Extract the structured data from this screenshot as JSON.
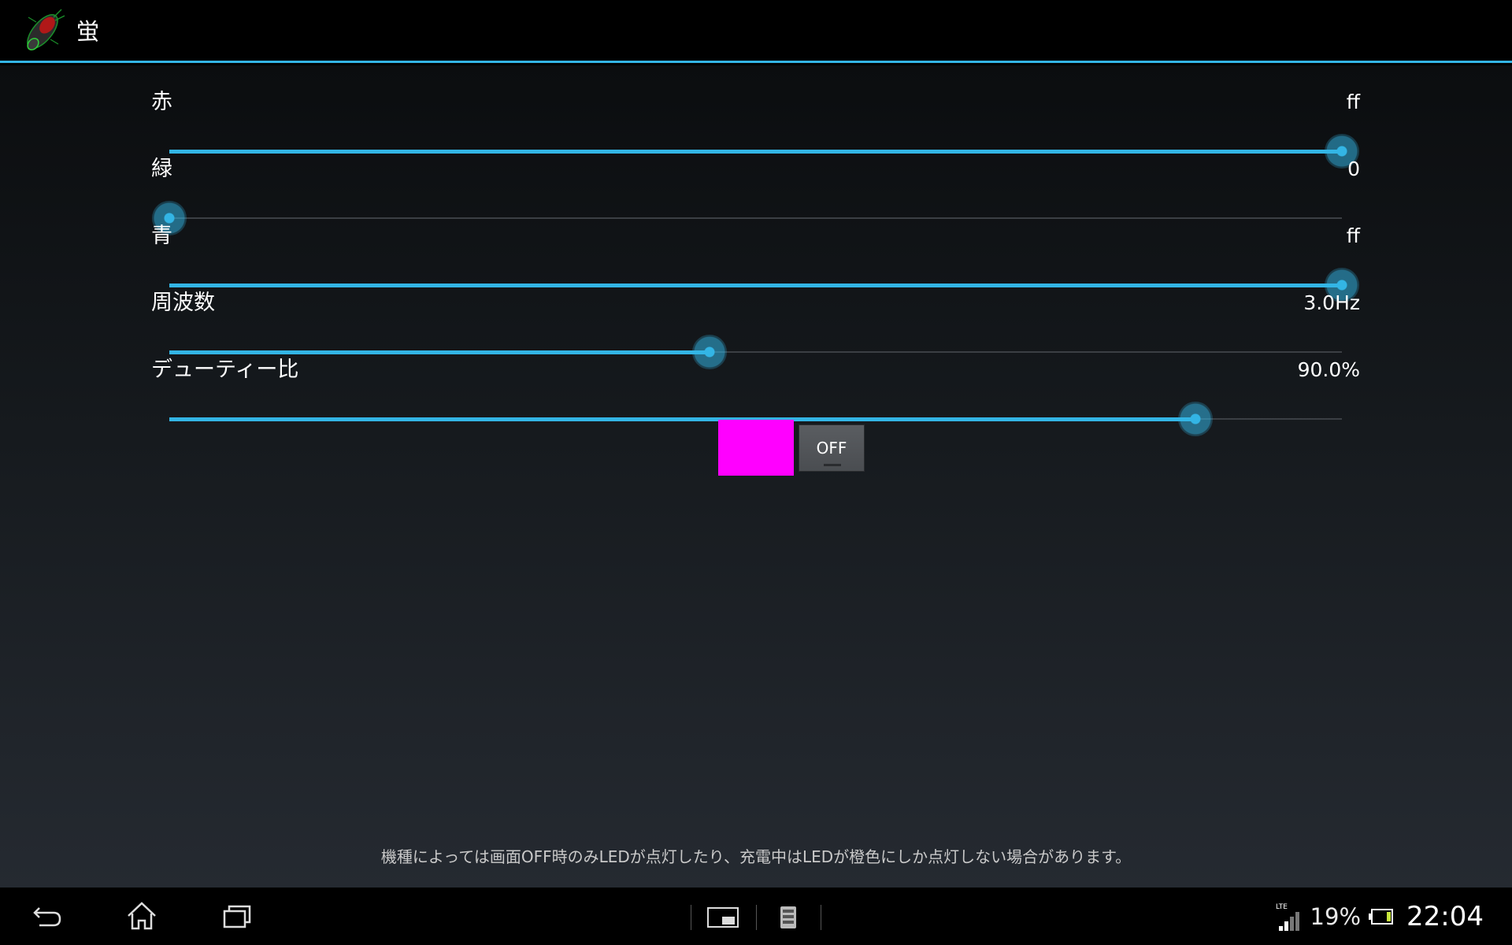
{
  "app": {
    "title": "蛍",
    "icon": "firefly-app-icon"
  },
  "sliders": [
    {
      "label": "赤",
      "value_text": "ff",
      "level": 1.0
    },
    {
      "label": "緑",
      "value_text": "0",
      "level": 0.0
    },
    {
      "label": "青",
      "value_text": "ff",
      "level": 1.0
    },
    {
      "label": "周波数",
      "value_text": "3.0Hz",
      "level": 0.461
    },
    {
      "label": "デューティー比",
      "value_text": "90.0%",
      "level": 0.875
    }
  ],
  "preview": {
    "color": "#ff00ff",
    "toggle_label": "OFF"
  },
  "notice": "機種によっては画面OFF時のみLEDが点灯したり、充電中はLEDが橙色にしか点灯しない場合があります。",
  "status": {
    "network": "LTE",
    "battery": "19%",
    "time": "22:04"
  },
  "accent_color": "#33b5e5"
}
